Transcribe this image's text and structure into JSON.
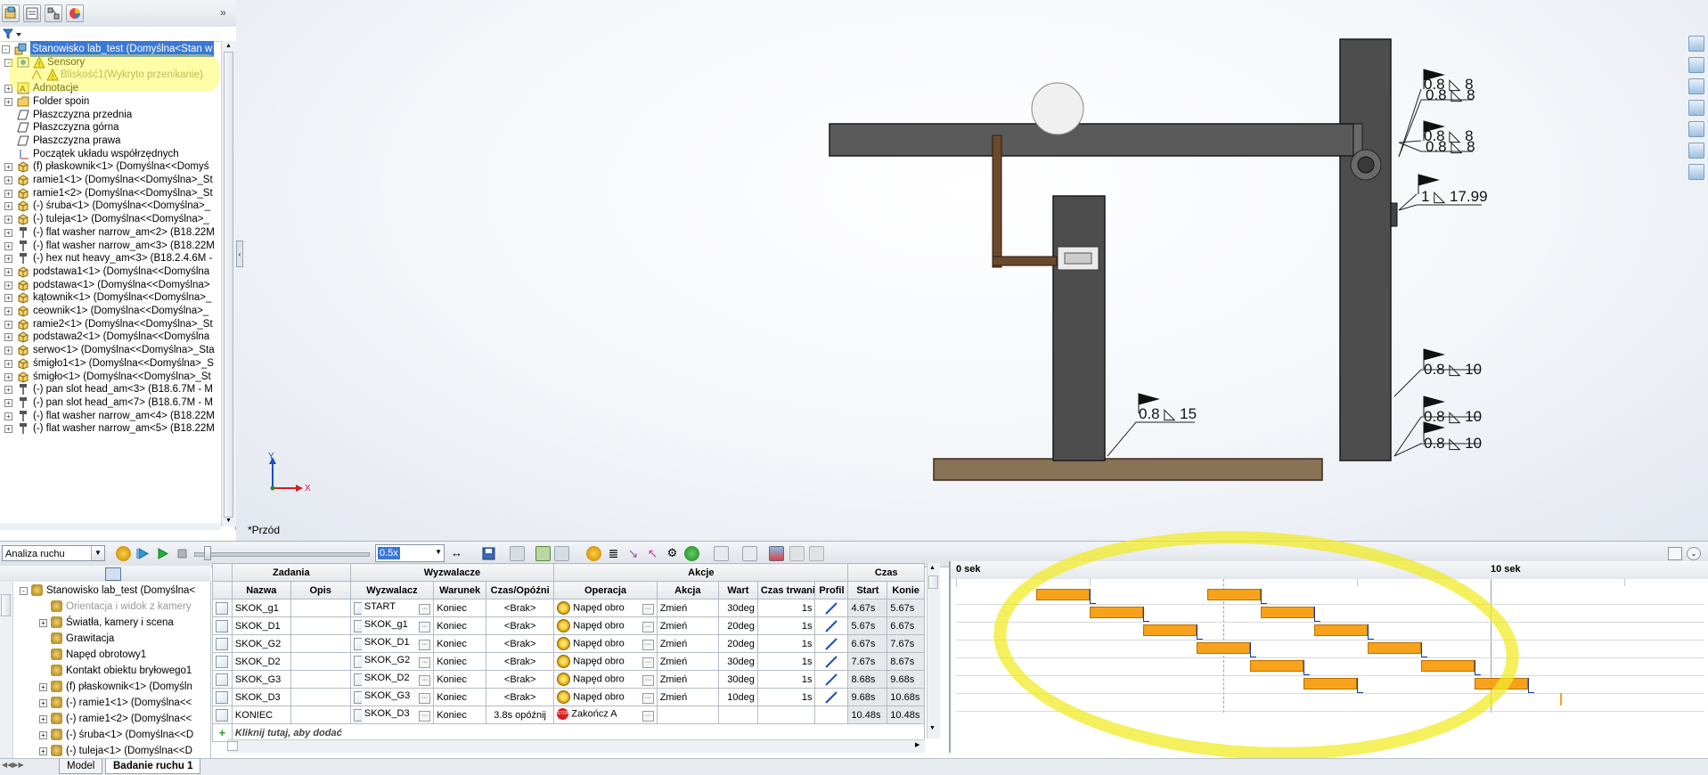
{
  "tree": {
    "items": [
      {
        "label": "Stanowisko lab_test  (Domyślna<Stan w",
        "level": 0,
        "exp": "-",
        "icon": "assembly",
        "selected": true
      },
      {
        "label": "Sensory",
        "level": 1,
        "exp": "-",
        "icon": "sensor",
        "warn": true
      },
      {
        "label": "Bliskość1(Wykryto przenikanie)",
        "level": 2,
        "exp": "",
        "icon": "proximity",
        "warn": true,
        "dim": true
      },
      {
        "label": "Adnotacje",
        "level": 1,
        "exp": "+",
        "icon": "annotation"
      },
      {
        "label": "Folder spoin",
        "level": 1,
        "exp": "+",
        "icon": "folder"
      },
      {
        "label": "Płaszczyzna przednia",
        "level": 1,
        "exp": "",
        "icon": "plane"
      },
      {
        "label": "Płaszczyzna górna",
        "level": 1,
        "exp": "",
        "icon": "plane"
      },
      {
        "label": "Płaszczyzna prawa",
        "level": 1,
        "exp": "",
        "icon": "plane"
      },
      {
        "label": "Początek układu współrzędnych",
        "level": 1,
        "exp": "",
        "icon": "origin"
      },
      {
        "label": "(f) płaskownik<1> (Domyślna<<Domyś",
        "level": 1,
        "exp": "+",
        "icon": "part"
      },
      {
        "label": "ramie1<1> (Domyślna<<Domyślna>_St",
        "level": 1,
        "exp": "+",
        "icon": "part"
      },
      {
        "label": "ramie1<2> (Domyślna<<Domyślna>_St",
        "level": 1,
        "exp": "+",
        "icon": "part"
      },
      {
        "label": "(-) śruba<1> (Domyślna<<Domyślna>_",
        "level": 1,
        "exp": "+",
        "icon": "part"
      },
      {
        "label": "(-) tuleja<1> (Domyślna<<Domyślna>_",
        "level": 1,
        "exp": "+",
        "icon": "part"
      },
      {
        "label": "(-) flat washer narrow_am<2> (B18.22M",
        "level": 1,
        "exp": "+",
        "icon": "toolbox"
      },
      {
        "label": "(-) flat washer narrow_am<3> (B18.22M",
        "level": 1,
        "exp": "+",
        "icon": "toolbox"
      },
      {
        "label": "(-) hex nut heavy_am<3> (B18.2.4.6M -",
        "level": 1,
        "exp": "+",
        "icon": "toolbox"
      },
      {
        "label": "podstawa1<1> (Domyślna<<Domyślna",
        "level": 1,
        "exp": "+",
        "icon": "part"
      },
      {
        "label": "podstawa<1> (Domyślna<<Domyślna>",
        "level": 1,
        "exp": "+",
        "icon": "part"
      },
      {
        "label": "kątownik<1> (Domyślna<<Domyślna>_",
        "level": 1,
        "exp": "+",
        "icon": "part"
      },
      {
        "label": "ceownik<1> (Domyślna<<Domyślna>_",
        "level": 1,
        "exp": "+",
        "icon": "part"
      },
      {
        "label": "ramie2<1> (Domyślna<<Domyślna>_St",
        "level": 1,
        "exp": "+",
        "icon": "part"
      },
      {
        "label": "podstawa2<1> (Domyślna<<Domyślna",
        "level": 1,
        "exp": "+",
        "icon": "part"
      },
      {
        "label": "serwo<1> (Domyślna<<Domyślna>_Sta",
        "level": 1,
        "exp": "+",
        "icon": "part"
      },
      {
        "label": "śmigło1<1> (Domyślna<<Domyślna>_S",
        "level": 1,
        "exp": "+",
        "icon": "part"
      },
      {
        "label": "śmigło<1> (Domyślna<<Domyślna>_St",
        "level": 1,
        "exp": "+",
        "icon": "part"
      },
      {
        "label": "(-) pan slot head_am<3> (B18.6.7M - M",
        "level": 1,
        "exp": "+",
        "icon": "toolbox"
      },
      {
        "label": "(-) pan slot head_am<7> (B18.6.7M - M",
        "level": 1,
        "exp": "+",
        "icon": "toolbox"
      },
      {
        "label": "(-) flat washer narrow_am<4> (B18.22M",
        "level": 1,
        "exp": "+",
        "icon": "toolbox"
      },
      {
        "label": "(-) flat washer narrow_am<5> (B18.22M",
        "level": 1,
        "exp": "+",
        "icon": "toolbox"
      }
    ]
  },
  "viewport": {
    "view_name": "*Przód",
    "triad": {
      "y": "Y",
      "x": "X"
    },
    "welds": [
      {
        "text": "0.8",
        "size": "8"
      },
      {
        "text": "0.8",
        "size": "8"
      },
      {
        "text": "0.8",
        "size": "8"
      },
      {
        "text": "0.8",
        "size": "8"
      },
      {
        "text": "1",
        "size": "17.99"
      },
      {
        "text": "0.8",
        "size": "10"
      },
      {
        "text": "0.8",
        "size": "10"
      },
      {
        "text": "0.8",
        "size": "10"
      },
      {
        "text": "0.8",
        "size": "15"
      }
    ]
  },
  "motion_toolbar": {
    "study_type": "Analiza ruchu",
    "speed": "0.5x"
  },
  "motion_tree": {
    "items": [
      {
        "label": "Stanowisko lab_test  (Domyślna<",
        "exp": "-",
        "indent": 0
      },
      {
        "label": "Orientacja i widok z kamery",
        "exp": "",
        "indent": 1,
        "dim": true
      },
      {
        "label": "Światła, kamery i scena",
        "exp": "+",
        "indent": 1
      },
      {
        "label": "Grawitacja",
        "exp": "",
        "indent": 1
      },
      {
        "label": "Napęd obrotowy1",
        "exp": "",
        "indent": 1
      },
      {
        "label": "Kontakt obiektu bryłowego1",
        "exp": "",
        "indent": 1
      },
      {
        "label": "(f) płaskownik<1> (Domyśln",
        "exp": "+",
        "indent": 1
      },
      {
        "label": "(-) ramie1<1> (Domyślna<<",
        "exp": "+",
        "indent": 1
      },
      {
        "label": "(-) ramie1<2> (Domyślna<<",
        "exp": "+",
        "indent": 1
      },
      {
        "label": "(-) śruba<1> (Domyślna<<D",
        "exp": "+",
        "indent": 1
      },
      {
        "label": "(-) tuleja<1> (Domyślna<<D",
        "exp": "+",
        "indent": 1
      }
    ]
  },
  "table": {
    "groups": {
      "tasks": "Zadania",
      "triggers": "Wyzwalacze",
      "actions": "Akcje",
      "time": "Czas"
    },
    "headers": [
      "Nazwa",
      "Opis",
      "Wyzwalacz",
      "Warunek",
      "Czas/Opóźni",
      "Operacja",
      "Akcja",
      "Wart",
      "Czas trwania",
      "Profil",
      "Start",
      "Konie"
    ],
    "rows": [
      {
        "name": "SKOK_g1",
        "desc": "",
        "trigger": "START",
        "cond": "Koniec",
        "delay": "<Brak>",
        "op": "Napęd obro",
        "action": "Zmień",
        "value": "30deg",
        "duration": "1s",
        "start": "4.67s",
        "end": "5.67s"
      },
      {
        "name": "SKOK_D1",
        "desc": "",
        "trigger": "SKOK_g1",
        "cond": "Koniec",
        "delay": "<Brak>",
        "op": "Napęd obro",
        "action": "Zmień",
        "value": "20deg",
        "duration": "1s",
        "start": "5.67s",
        "end": "6.67s"
      },
      {
        "name": "SKOK_G2",
        "desc": "",
        "trigger": "SKOK_D1",
        "cond": "Koniec",
        "delay": "<Brak>",
        "op": "Napęd obro",
        "action": "Zmień",
        "value": "20deg",
        "duration": "1s",
        "start": "6.67s",
        "end": "7.67s"
      },
      {
        "name": "SKOK_D2",
        "desc": "",
        "trigger": "SKOK_G2",
        "cond": "Koniec",
        "delay": "<Brak>",
        "op": "Napęd obro",
        "action": "Zmień",
        "value": "30deg",
        "duration": "1s",
        "start": "7.67s",
        "end": "8.67s"
      },
      {
        "name": "SKOK_G3",
        "desc": "",
        "trigger": "SKOK_D2",
        "cond": "Koniec",
        "delay": "<Brak>",
        "op": "Napęd obro",
        "action": "Zmień",
        "value": "30deg",
        "duration": "1s",
        "start": "8.68s",
        "end": "9.68s"
      },
      {
        "name": "SKOK_D3",
        "desc": "",
        "trigger": "SKOK_G3",
        "cond": "Koniec",
        "delay": "<Brak>",
        "op": "Napęd obro",
        "action": "Zmień",
        "value": "10deg",
        "duration": "1s",
        "start": "9.68s",
        "end": "10.68s"
      },
      {
        "name": "KONIEC",
        "desc": "",
        "trigger": "SKOK_D3",
        "cond": "Koniec",
        "delay": "3.8s opóźnij",
        "op": "Zakończ A",
        "action": "",
        "value": "",
        "duration": "",
        "start": "10.48s",
        "end": "10.48s",
        "stop": true
      }
    ],
    "add_row": "Kliknij tutaj, aby dodać"
  },
  "timeline": {
    "label_0": "0 sek",
    "label_10": "10 sek",
    "rows": [
      [
        [
          1.5,
          2.5
        ],
        [
          4.7,
          5.7
        ]
      ],
      [
        [
          2.5,
          3.5
        ],
        [
          5.7,
          6.7
        ]
      ],
      [
        [
          3.5,
          4.5
        ],
        [
          6.7,
          7.7
        ]
      ],
      [
        [
          4.5,
          5.5
        ],
        [
          7.7,
          8.7
        ]
      ],
      [
        [
          5.5,
          6.5
        ],
        [
          8.7,
          9.7
        ]
      ],
      [
        [
          6.5,
          7.5
        ],
        [
          9.7,
          10.7
        ]
      ],
      []
    ],
    "marker_s": 11.3
  },
  "bottom_tabs": {
    "model": "Model",
    "study": "Badanie ruchu 1"
  },
  "colors": {
    "segment": "#f8a21c",
    "highlight": "#f0eb28",
    "selection": "#3a78d8"
  }
}
